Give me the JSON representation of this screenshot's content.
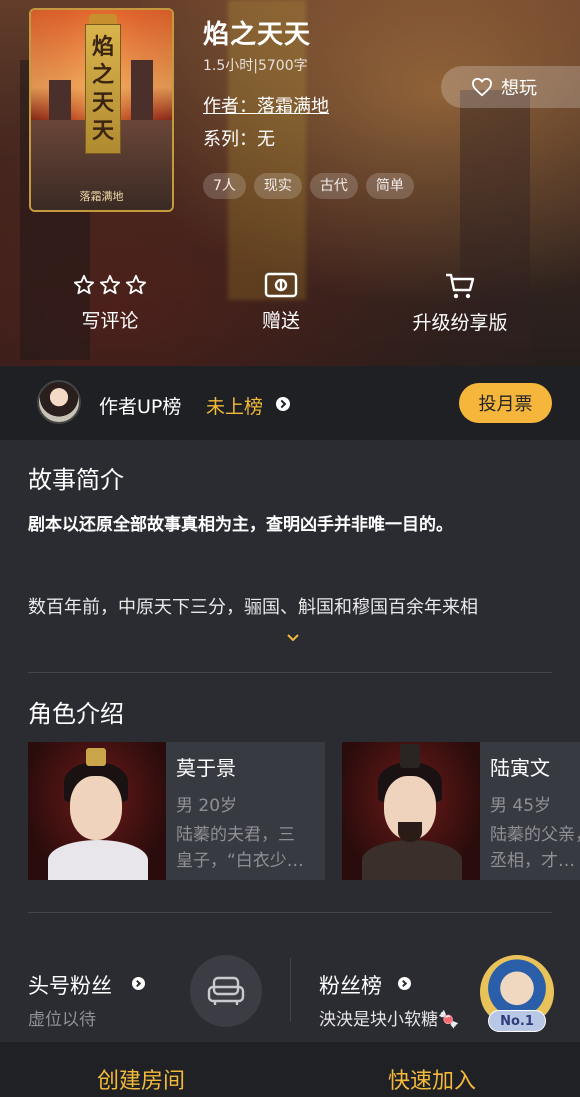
{
  "book": {
    "title": "焰之天天",
    "meta": "1.5小时|5700字",
    "author_label": "作者：",
    "author_name": "落霜满地",
    "series": "系列：无",
    "cover_title_chars": [
      "焰",
      "之",
      "天",
      "天"
    ],
    "cover_author": "落霜满地",
    "tags": [
      "7人",
      "现实",
      "古代",
      "简单"
    ]
  },
  "want_button": {
    "label": "想玩",
    "icon": "heart-icon"
  },
  "actions": [
    {
      "label": "写评论",
      "icon": "star-outline-icon"
    },
    {
      "label": "赠送",
      "icon": "gift-card-icon"
    },
    {
      "label": "升级纷享版",
      "icon": "cart-icon"
    }
  ],
  "up_rank": {
    "label": "作者UP榜",
    "status": "未上榜",
    "vote_button": "投月票"
  },
  "story": {
    "heading": "故事简介",
    "tagline": "剧本以还原全部故事真相为主，查明凶手并非唯一目的。",
    "intro": "数百年前，中原天下三分，骊国、斛国和穆国百余年来相"
  },
  "roles": {
    "heading": "角色介绍",
    "items": [
      {
        "name": "莫于景",
        "meta": "男  20岁",
        "desc": "陆蓁的夫君，三皇子，“白衣少…"
      },
      {
        "name": "陆寅文",
        "meta": "男  45岁",
        "desc": "陆蓁的父亲，国丞相，才…"
      }
    ]
  },
  "fans": {
    "top_fan_title": "头号粉丝",
    "top_fan_sub": "虚位以待",
    "board_title": "粉丝榜",
    "board_sub": "泱泱是块小软糖🍬",
    "rank_badge": "No.1"
  },
  "bottom": {
    "create_room": "创建房间",
    "quick_join": "快速加入"
  },
  "colors": {
    "accent": "#f3b93a",
    "vote_bg": "#f6b63b",
    "page_bg": "#2b2c31",
    "bar_bg": "#1f2024"
  }
}
